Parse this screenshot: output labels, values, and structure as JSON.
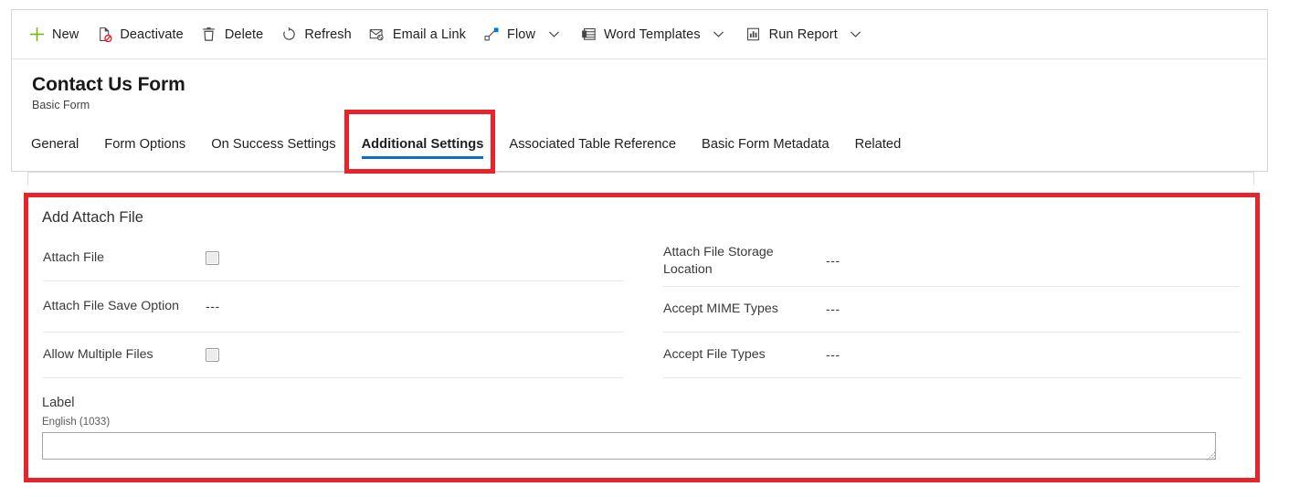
{
  "commandbar": {
    "items": [
      {
        "label": "New",
        "icon": "plus-icon",
        "has_caret": false
      },
      {
        "label": "Deactivate",
        "icon": "deactivate-icon",
        "has_caret": false
      },
      {
        "label": "Delete",
        "icon": "trash-icon",
        "has_caret": false
      },
      {
        "label": "Refresh",
        "icon": "refresh-icon",
        "has_caret": false
      },
      {
        "label": "Email a Link",
        "icon": "email-link-icon",
        "has_caret": false
      },
      {
        "label": "Flow",
        "icon": "flow-icon",
        "has_caret": true
      },
      {
        "label": "Word Templates",
        "icon": "word-template-icon",
        "has_caret": true
      },
      {
        "label": "Run Report",
        "icon": "run-report-icon",
        "has_caret": true
      }
    ]
  },
  "record": {
    "title": "Contact Us Form",
    "subtitle": "Basic Form"
  },
  "tabs": [
    {
      "label": "General",
      "active": false
    },
    {
      "label": "Form Options",
      "active": false
    },
    {
      "label": "On Success Settings",
      "active": false
    },
    {
      "label": "Additional Settings",
      "active": true
    },
    {
      "label": "Associated Table Reference",
      "active": false
    },
    {
      "label": "Basic Form Metadata",
      "active": false
    },
    {
      "label": "Related",
      "active": false
    }
  ],
  "section": {
    "title": "Add Attach File",
    "left_fields": [
      {
        "label": "Attach File",
        "control": "checkbox",
        "value": "",
        "checked": false
      },
      {
        "label": "Attach File Save Option",
        "control": "text",
        "value": "---"
      },
      {
        "label": "Allow Multiple Files",
        "control": "checkbox",
        "value": "",
        "checked": false
      }
    ],
    "right_fields": [
      {
        "label": "Attach File Storage Location",
        "control": "text",
        "value": "---"
      },
      {
        "label": "Accept MIME Types",
        "control": "text",
        "value": "---"
      },
      {
        "label": "Accept File Types",
        "control": "text",
        "value": "---"
      }
    ],
    "label_block": {
      "title": "Label",
      "language": "English (1033)",
      "value": "",
      "placeholder": ""
    }
  },
  "annotations": [
    {
      "name": "highlight-additional-settings-tab"
    },
    {
      "name": "highlight-add-attach-file-section"
    }
  ],
  "colors": {
    "accent": "#0a6ed1",
    "annotation": "#e8232a",
    "text": "#201f1e"
  }
}
